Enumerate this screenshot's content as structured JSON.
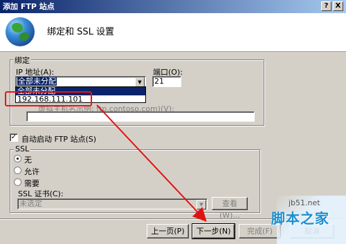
{
  "window": {
    "title": "添加 FTP 站点",
    "help_btn": "?",
    "close_btn": "X"
  },
  "header": {
    "title": "绑定和 SSL 设置",
    "icon": "globe-icon"
  },
  "binding": {
    "group_label": "绑定",
    "ip_label": "IP 地址(A):",
    "ip_value": "全部未分配",
    "port_label": "端口(O):",
    "port_value": "21",
    "dropdown_options": [
      "全部未分配",
      "192.168.111.101"
    ],
    "hostname_hint": "虚拟主机名示例: ftp.contoso.com)(V):",
    "hostname_value": ""
  },
  "autostart": {
    "label": "自动启动 FTP 站点(S)",
    "checked": true
  },
  "ssl": {
    "group_label": "SSL",
    "options": [
      "无",
      "允许",
      "需要"
    ],
    "selected": "无",
    "cert_label": "SSL 证书(C):",
    "cert_value": "未选定",
    "view_btn": "查看(W)..."
  },
  "buttons": {
    "prev": "上一页(P)",
    "next": "下一步(N)",
    "finish": "完成(F)",
    "cancel": "取消"
  },
  "watermark": {
    "url": "jb51.net",
    "text": "脚本之家"
  },
  "colors": {
    "annotation": "#e11111",
    "title_bar": "#0a246a",
    "selection": "#0a246a"
  }
}
